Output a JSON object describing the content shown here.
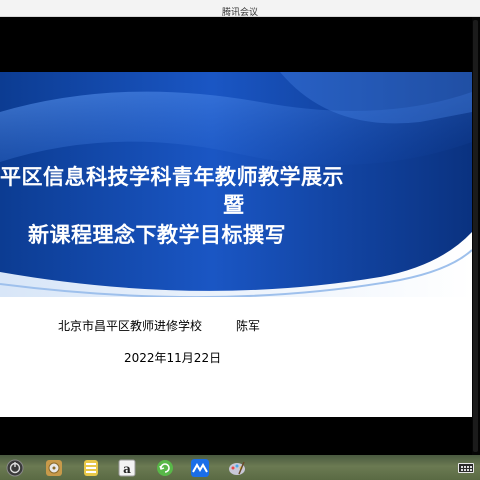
{
  "window": {
    "title": "腾讯会议"
  },
  "slide": {
    "title_line1": "平区信息科技学科青年教师教学展示",
    "title_line2": "暨",
    "title_line3": "新课程理念下教学目标撰写",
    "organization": "北京市昌平区教师进修学校",
    "author": "陈军",
    "date": "2022年11月22日"
  },
  "taskbar": {
    "icons": [
      "power-icon",
      "disk-icon",
      "app-icon",
      "font-viewer-icon",
      "refresh-icon",
      "tencent-meeting-icon",
      "paint-icon",
      "keyboard-icon"
    ]
  },
  "colors": {
    "banner_dark": "#0a3a8c",
    "banner_light": "#3a7ae0",
    "taskbar": "#5a6a44"
  }
}
